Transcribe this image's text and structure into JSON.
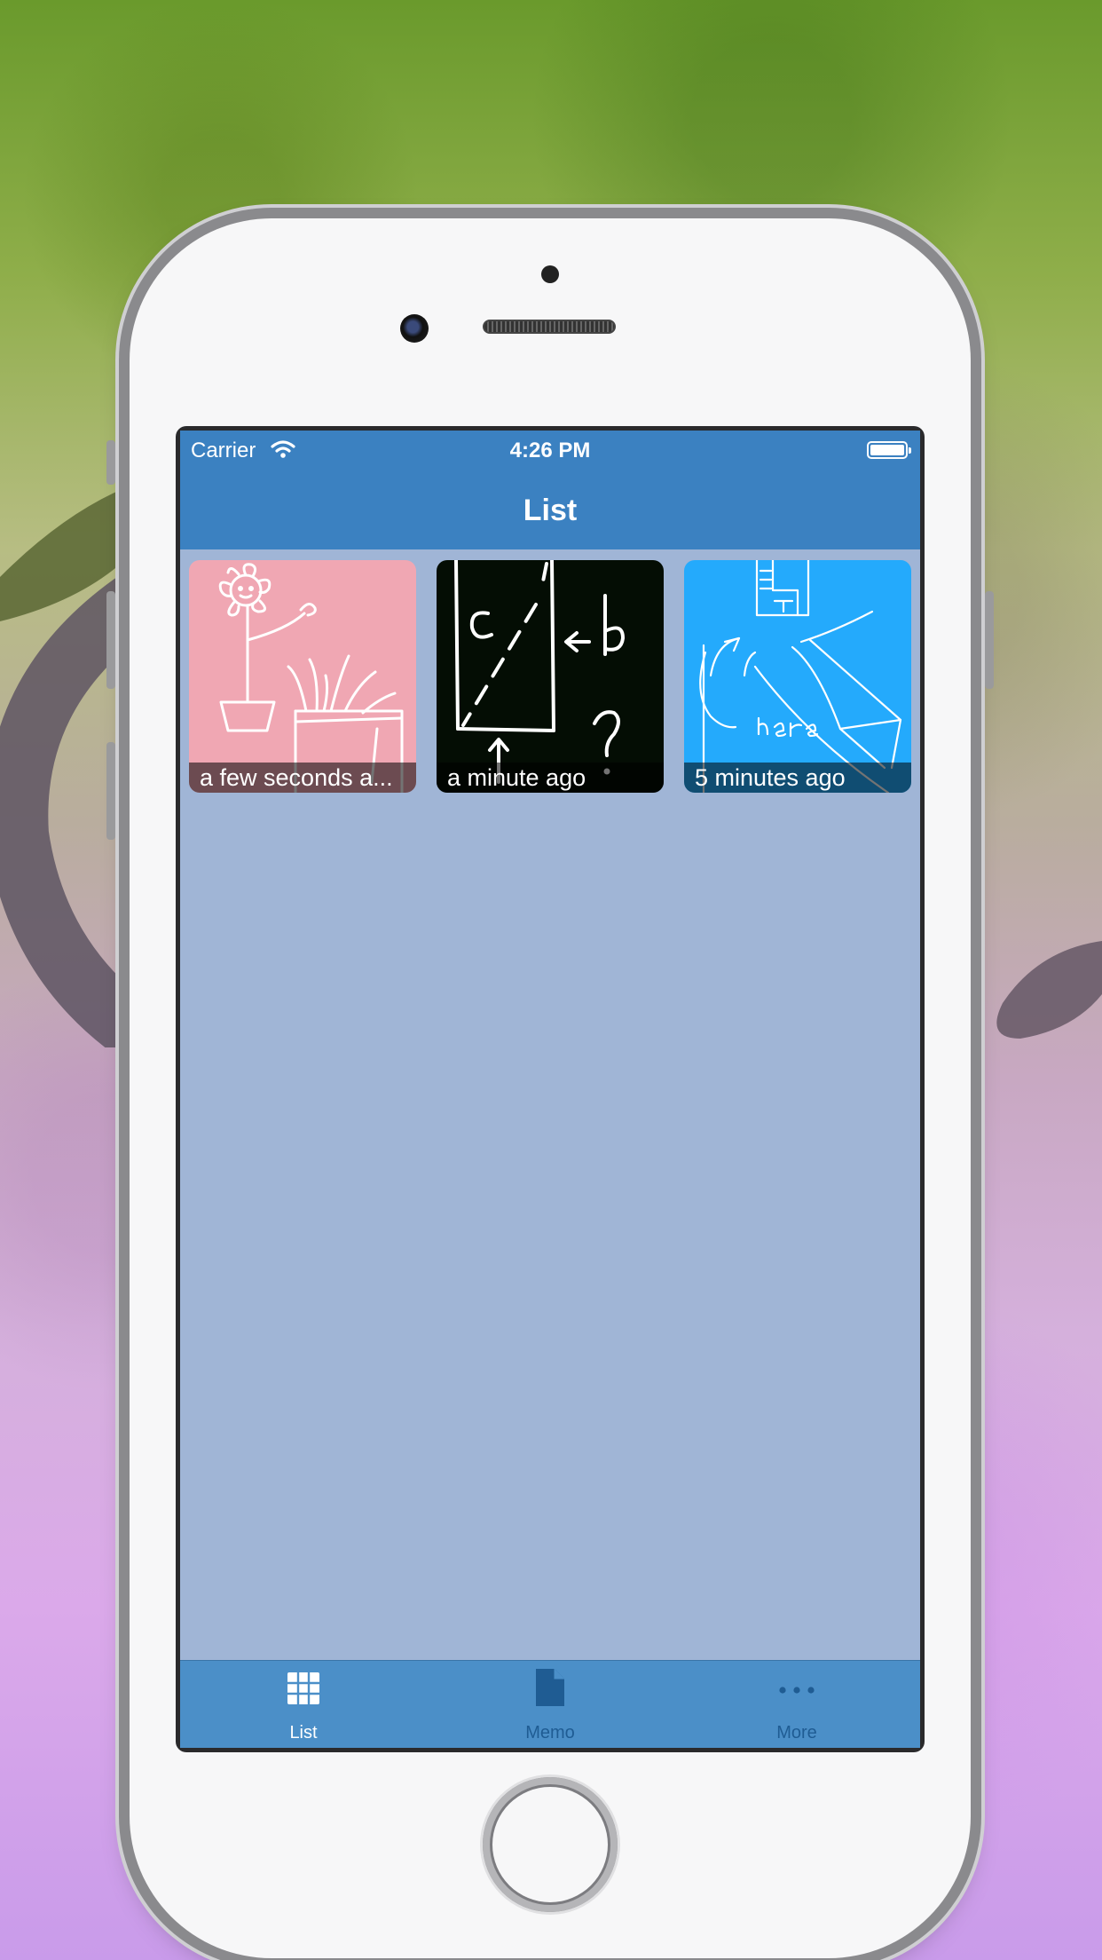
{
  "status_bar": {
    "carrier": "Carrier",
    "time": "4:26 PM"
  },
  "nav": {
    "title": "List"
  },
  "items": [
    {
      "label": "a few seconds a...",
      "bg": "#f0a7b3"
    },
    {
      "label": "a minute ago",
      "bg": "#040d04"
    },
    {
      "label": "5 minutes ago",
      "bg": "#24aafc"
    }
  ],
  "tabs": [
    {
      "label": "List",
      "icon": "grid-icon",
      "active": true
    },
    {
      "label": "Memo",
      "icon": "document-icon",
      "active": false
    },
    {
      "label": "More",
      "icon": "more-dots-icon",
      "active": false
    }
  ],
  "colors": {
    "bar": "#3b81c1",
    "tabbar": "#4b8fc8",
    "content": "#a0b5d6",
    "tab_active": "#ffffff",
    "tab_inactive": "#1f5c93"
  }
}
